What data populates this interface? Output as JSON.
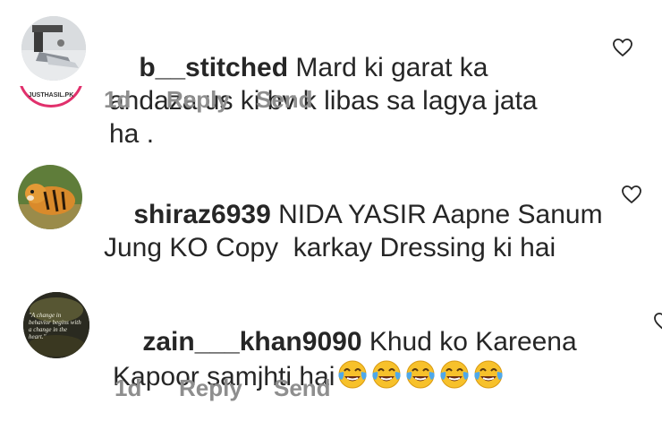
{
  "comments": [
    {
      "username": "b__stitched",
      "text": " Mard ki garat ka andaza us ki bv k libas sa lagya jata ha .",
      "time": "1d",
      "reply": "Reply",
      "send": "Send",
      "badge": "JUSTHASIL.PK",
      "avatar_icon": "sewing-machine-icon"
    },
    {
      "username": "shiraz6939",
      "text": " NIDA YASIR Aapne Sanum Jung KO Copy  karkay Dressing ki hai",
      "avatar_icon": "tiger-icon"
    },
    {
      "username": "zain___khan9090",
      "text": " Khud ko Kareena Kapoor samjhti hai",
      "time": "1d",
      "reply": "Reply",
      "send": "Send",
      "avatar_quote": "\"A change in behavior begins with a change in the heart.\"",
      "emoji_name": "face-with-tears-of-joy",
      "emoji_count": 5
    }
  ],
  "colors": {
    "text": "#262626",
    "meta": "#8e8e8e",
    "heart_stroke": "#262626",
    "emoji_yellow": "#f7c12b",
    "emoji_tear": "#4ea8ea"
  }
}
